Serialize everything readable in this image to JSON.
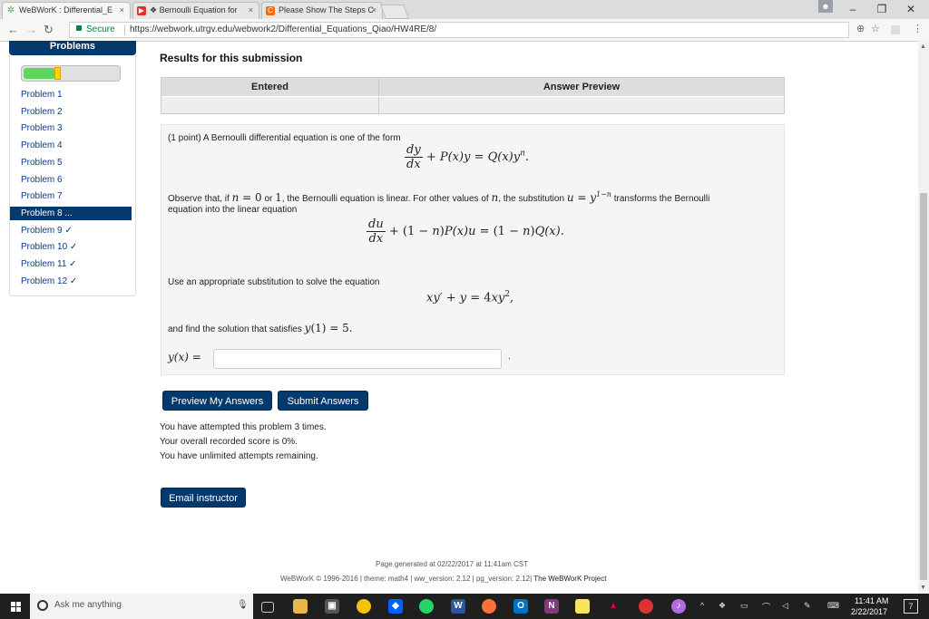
{
  "browser": {
    "tabs": [
      {
        "title": "WeBWorK : Differential_E",
        "icon_color": "#4caf50"
      },
      {
        "title": "❖ Bernoulli Equation for",
        "icon_color": "#e52d27"
      },
      {
        "title": "Please Show The Steps C",
        "icon_color": "#ff6a00"
      }
    ],
    "close_glyph": "×",
    "secure_label": "Secure",
    "url": "https://webwork.utrgv.edu/webwork2/Differential_Equations_Qiao/HW4RE/8/",
    "win_min": "–",
    "win_max": "❐",
    "win_close": "✕"
  },
  "sidebar": {
    "header": "Problems",
    "progress_fraction": 0.33,
    "problems": [
      {
        "label": "Problem 1"
      },
      {
        "label": "Problem 2"
      },
      {
        "label": "Problem 3"
      },
      {
        "label": "Problem 4"
      },
      {
        "label": "Problem 5"
      },
      {
        "label": "Problem 6"
      },
      {
        "label": "Problem 7"
      },
      {
        "label": "Problem 8 ...",
        "current": true
      },
      {
        "label": "Problem 9 ✓"
      },
      {
        "label": "Problem 10 ✓"
      },
      {
        "label": "Problem 11 ✓"
      },
      {
        "label": "Problem 12 ✓"
      }
    ]
  },
  "results": {
    "title": "Results for this submission",
    "col_entered": "Entered",
    "col_preview": "Answer Preview"
  },
  "problem": {
    "intro": "(1 point) A Bernoulli differential equation is one of the form",
    "observe_1": "Observe that, if",
    "observe_2": "or",
    "observe_3": ", the Bernoulli equation is linear. For other values of",
    "observe_4": ", the substitution",
    "observe_5": "transforms the Bernoulli",
    "observe_line2": "equation into the linear equation",
    "use_text": "Use an appropriate substitution to solve the equation",
    "find_text": "and find the solution that satisfies",
    "answer_label": "y(x) =",
    "answer_value": "",
    "trailing_period": "."
  },
  "buttons": {
    "preview": "Preview My Answers",
    "submit": "Submit Answers",
    "email": "Email instructor"
  },
  "attempts": {
    "line1": "You have attempted this problem 3 times.",
    "line2": "Your overall recorded score is 0%.",
    "line3": "You have unlimited attempts remaining."
  },
  "footer": {
    "generated": "Page generated at 02/22/2017 at 11:41am CST",
    "copyright": "WeBWorK © 1996-2016 | theme: math4 | ww_version: 2.12 | pg_version: 2.12|",
    "project_link": "The WeBWorK Project"
  },
  "taskbar": {
    "search_placeholder": "Ask me anything",
    "time": "11:41 AM",
    "date": "2/22/2017",
    "notification_count": "7"
  }
}
